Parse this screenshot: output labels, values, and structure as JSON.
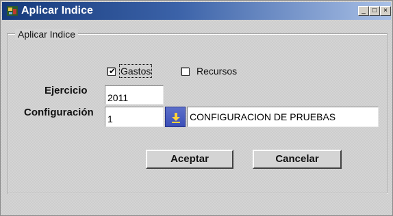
{
  "window": {
    "title": "Aplicar Indice",
    "controls": {
      "minimize": "_",
      "maximize": "□",
      "close": "×"
    }
  },
  "group": {
    "label": "Aplicar Indice"
  },
  "options": {
    "gastos": {
      "label": "Gastos",
      "checked": true
    },
    "recursos": {
      "label": "Recursos",
      "checked": false
    }
  },
  "form": {
    "ejercicio": {
      "label": "Ejercicio",
      "value": "2011"
    },
    "configuracion": {
      "label": "Configuración",
      "value": "1",
      "description": "CONFIGURACION DE PRUEBAS"
    }
  },
  "buttons": {
    "accept": "Aceptar",
    "cancel": "Cancelar"
  },
  "icons": {
    "app": "app-icon",
    "lookup": "arrow-down-icon"
  },
  "colors": {
    "titlebar_start": "#163a7b",
    "titlebar_end": "#a9c0e6",
    "lookup_button": "#4a5ec0"
  }
}
